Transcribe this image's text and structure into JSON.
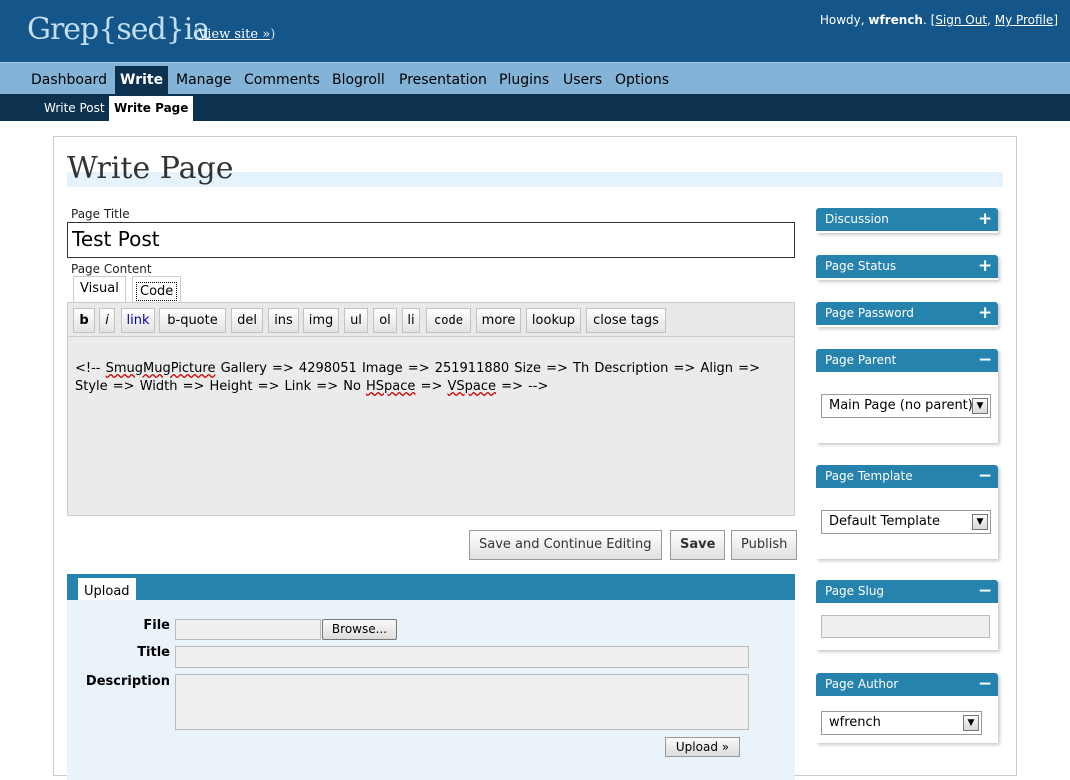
{
  "header": {
    "site_title": "Grep{sed}ia",
    "view_site_open": "(",
    "view_site": "View site »",
    "view_site_close": ")",
    "howdy": "Howdy,",
    "username": "wfrench",
    "period": ".",
    "bracket_open": "[",
    "sign_out": "Sign Out",
    "comma": ",",
    "my_profile": "My Profile",
    "bracket_close": "]"
  },
  "menu": {
    "items": [
      "Dashboard",
      "Write",
      "Manage",
      "Comments",
      "Blogroll",
      "Presentation",
      "Plugins",
      "Users",
      "Options"
    ],
    "current": "Write"
  },
  "submenu": {
    "items": [
      "Write Post",
      "Write Page"
    ],
    "current": "Write Page"
  },
  "page": {
    "heading": "Write Page",
    "title_label": "Page Title",
    "title_value": "Test Post",
    "content_label": "Page Content",
    "tabs": [
      "Visual",
      "Code"
    ],
    "active_tab": "Code",
    "toolbar": [
      "b",
      "i",
      "link",
      "b-quote",
      "del",
      "ins",
      "img",
      "ul",
      "ol",
      "li",
      "code",
      "more",
      "lookup",
      "close tags"
    ],
    "content": {
      "p1": "<!-- ",
      "w1": "SmugMugPicture",
      "p2": "  Gallery => 4298051 Image => 251911880 Size => Th Description =>  Align =>  Style =>  Width =>  Height =>  Link => No ",
      "w2": "HSpace",
      "p3": " =>  ",
      "w3": "VSpace",
      "p4": " => -->"
    },
    "buttons": {
      "save_continue": "Save and Continue Editing",
      "save": "Save",
      "publish": "Publish"
    }
  },
  "upload": {
    "tab": "Upload",
    "file_label": "File",
    "browse": "Browse...",
    "title_label": "Title",
    "description_label": "Description",
    "submit": "Upload »"
  },
  "sidebar": {
    "discussion": "Discussion",
    "page_status": "Page Status",
    "page_password": "Page Password",
    "page_parent": "Page Parent",
    "page_parent_value": "Main Page (no parent)",
    "page_template": "Page Template",
    "page_template_value": "Default Template",
    "page_slug": "Page Slug",
    "page_author": "Page Author",
    "page_author_value": "wfrench",
    "expand_symbol": "+",
    "collapse_symbol": "−"
  },
  "colors": {
    "header_bg": "#14568a",
    "menu_bg": "#83b4d8",
    "submenu_bg": "#0d324f",
    "box_head": "#2683ae"
  }
}
